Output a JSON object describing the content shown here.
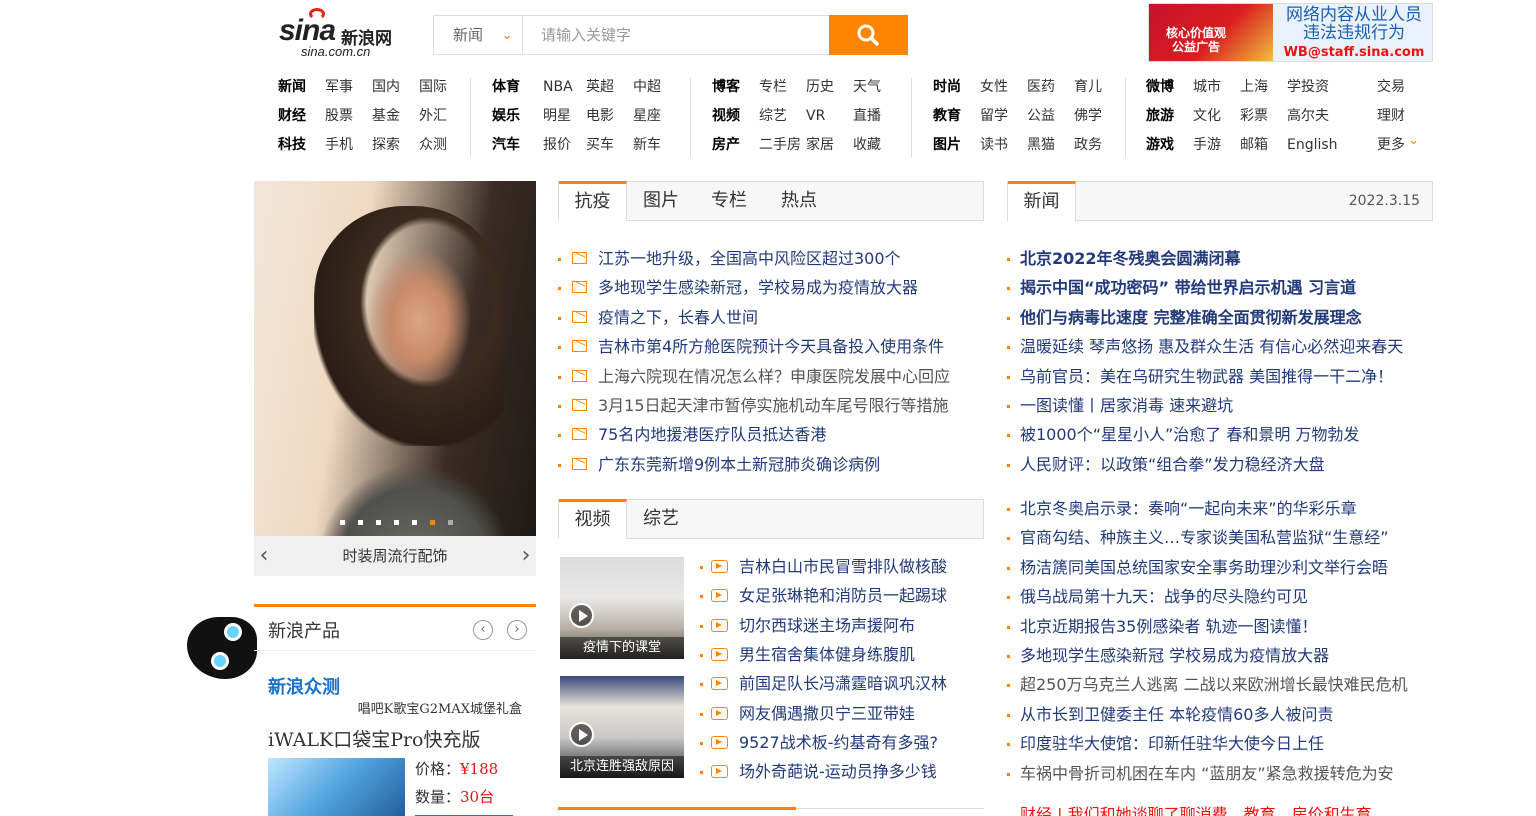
{
  "logo": {
    "brand": "sina",
    "cn": "新浪网",
    "domain": "sina.com.cn"
  },
  "search": {
    "category": "新闻",
    "placeholder": "请输入关键字"
  },
  "ad": {
    "flag_text": "核心价值观公益广告",
    "line1": "网络内容从业人员",
    "line2": "违法违规行为",
    "email": "WB@staff.sina.com"
  },
  "nav": {
    "row1": [
      [
        "新闻",
        "军事",
        "国内",
        "国际"
      ],
      [
        "体育",
        "NBA",
        "英超",
        "中超"
      ],
      [
        "博客",
        "专栏",
        "历史",
        "天气"
      ],
      [
        "时尚",
        "女性",
        "医药",
        "育儿"
      ],
      [
        "微博",
        "城市",
        "上海",
        "学投资"
      ],
      [
        "交易"
      ]
    ],
    "row2": [
      [
        "财经",
        "股票",
        "基金",
        "外汇"
      ],
      [
        "娱乐",
        "明星",
        "电影",
        "星座"
      ],
      [
        "视频",
        "综艺",
        "VR",
        "直播"
      ],
      [
        "教育",
        "留学",
        "公益",
        "佛学"
      ],
      [
        "旅游",
        "文化",
        "彩票",
        "高尔夫"
      ],
      [
        "理财"
      ]
    ],
    "row3": [
      [
        "科技",
        "手机",
        "探索",
        "众测"
      ],
      [
        "汽车",
        "报价",
        "买车",
        "新车"
      ],
      [
        "房产",
        "二手房",
        "家居",
        "收藏"
      ],
      [
        "图片",
        "读书",
        "黑猫",
        "政务"
      ],
      [
        "游戏",
        "手游",
        "邮箱",
        "English"
      ],
      [
        "更多"
      ]
    ]
  },
  "carousel": {
    "caption": "时装周流行配饰",
    "active_index": 5,
    "count": 7
  },
  "products": {
    "title": "新浪产品",
    "zhongce": "新浪众测",
    "subtitle": "唱吧K歌宝G2MAX城堡礼盒",
    "product_name": "iWALK口袋宝Pro快充版",
    "price_label": "价格：",
    "price": "¥188",
    "qty_label": "数量：",
    "qty": "30台"
  },
  "tabs1": [
    "抗疫",
    "图片",
    "专栏",
    "热点"
  ],
  "tabs2": [
    "视频",
    "综艺"
  ],
  "news_tab": "新闻",
  "news_date": "2022.3.15",
  "epidemic_list": [
    "江苏一地升级，全国高中风险区超过300个",
    "多地现学生感染新冠，学校易成为疫情放大器",
    "疫情之下，长春人世间",
    "吉林市第4所方舱医院预计今天具备投入使用条件",
    "上海六院现在情况怎么样？申康医院发展中心回应",
    "3月15日起天津市暂停实施机动车尾号限行等措施",
    "75名内地援港医疗队员抵达香港",
    "广东东莞新增9例本土新冠肺炎确诊病例"
  ],
  "video_thumbs": [
    "疫情下的课堂",
    "北京连胜强敌原因"
  ],
  "video_list": [
    "吉林白山市民冒雪排队做核酸",
    "女足张琳艳和消防员一起踢球",
    "切尔西球迷主场声援阿布",
    "男生宿舍集体健身练腹肌",
    "前国足队长冯潇霆暗讽巩汉林",
    "网友偶遇撒贝宁三亚带娃",
    "9527战术板-约基奇有多强?",
    "场外奇葩说-运动员挣多少钱"
  ],
  "news_list_bold": [
    "北京2022年冬残奥会圆满闭幕",
    "揭示中国“成功密码” 带给世界启示机遇 习言道",
    "他们与病毒比速度 完整准确全面贯彻新发展理念"
  ],
  "news_list1": [
    "温暖延续 琴声悠扬 惠及群众生活 有信心必然迎来春天",
    "乌前官员：美在乌研究生物武器 美国推得一干二净！",
    "一图读懂丨居家消毒 速来避坑",
    "被1000个“星星小人”治愈了 春和景明 万物勃发",
    "人民财评：以政策“组合拳”发力稳经济大盘"
  ],
  "news_list2": [
    "北京冬奥启示录：奏响“一起向未来”的华彩乐章",
    "官商勾结、种族主义…专家谈美国私营监狱“生意经”",
    "杨洁篪同美国总统国家安全事务助理沙利文举行会晤",
    "俄乌战局第十九天：战争的尽头隐约可见",
    "北京近期报告35例感染者 轨迹一图读懂！",
    "多地现学生感染新冠 学校易成为疫情放大器",
    "超250万乌克兰人逃离 二战以来欧洲增长最快难民危机",
    "从市长到卫健委主任 本轮疫情60多人被问责",
    "印度驻华大使馆：印新任驻华大使今日上任",
    "车祸中骨折司机困在车内 “蓝朋友”紧急救援转危为安"
  ],
  "bottom_teaser": "财经 | 我们和她谈聊了聊消费、教育、房价和生育",
  "colors": {
    "accent": "#ff8400",
    "link": "#223a7a",
    "zhongce": "#1a73c9",
    "price": "#e11111"
  }
}
